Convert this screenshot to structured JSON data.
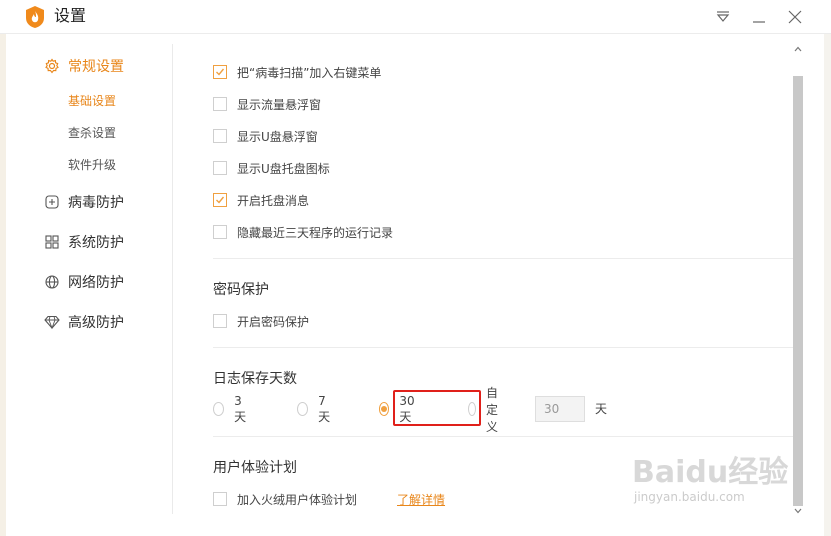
{
  "window": {
    "title": "设置"
  },
  "sidebar": {
    "items": [
      {
        "label": "常规设置",
        "icon": "gear-icon",
        "active": true
      },
      {
        "label": "病毒防护",
        "icon": "plus-box-icon"
      },
      {
        "label": "系统防护",
        "icon": "grid-icon"
      },
      {
        "label": "网络防护",
        "icon": "globe-icon"
      },
      {
        "label": "高级防护",
        "icon": "diamond-icon"
      }
    ],
    "subitems": [
      {
        "label": "基础设置",
        "active": true
      },
      {
        "label": "查杀设置"
      },
      {
        "label": "软件升级"
      }
    ]
  },
  "basic": {
    "options": [
      {
        "label": "把“病毒扫描”加入右键菜单",
        "checked": true
      },
      {
        "label": "显示流量悬浮窗",
        "checked": false
      },
      {
        "label": "显示U盘悬浮窗",
        "checked": false
      },
      {
        "label": "显示U盘托盘图标",
        "checked": false
      },
      {
        "label": "开启托盘消息",
        "checked": true
      },
      {
        "label": "隐藏最近三天程序的运行记录",
        "checked": false
      }
    ]
  },
  "password": {
    "title": "密码保护",
    "option": {
      "label": "开启密码保护",
      "checked": false
    }
  },
  "logs": {
    "title": "日志保存天数",
    "options": [
      {
        "label": "3天",
        "checked": false
      },
      {
        "label": "7天",
        "checked": false
      },
      {
        "label": "30天",
        "checked": true
      },
      {
        "label": "自定义",
        "checked": false
      }
    ],
    "custom_value": "30",
    "unit": "天"
  },
  "experience": {
    "title": "用户体验计划",
    "option": {
      "label": "加入火绒用户体验计划",
      "checked": false
    },
    "link": "了解详情"
  },
  "watermark": {
    "logo": "Baidu经验",
    "url": "jingyan.baidu.com"
  },
  "colors": {
    "accent": "#e8861a",
    "highlight": "#e0201a"
  }
}
